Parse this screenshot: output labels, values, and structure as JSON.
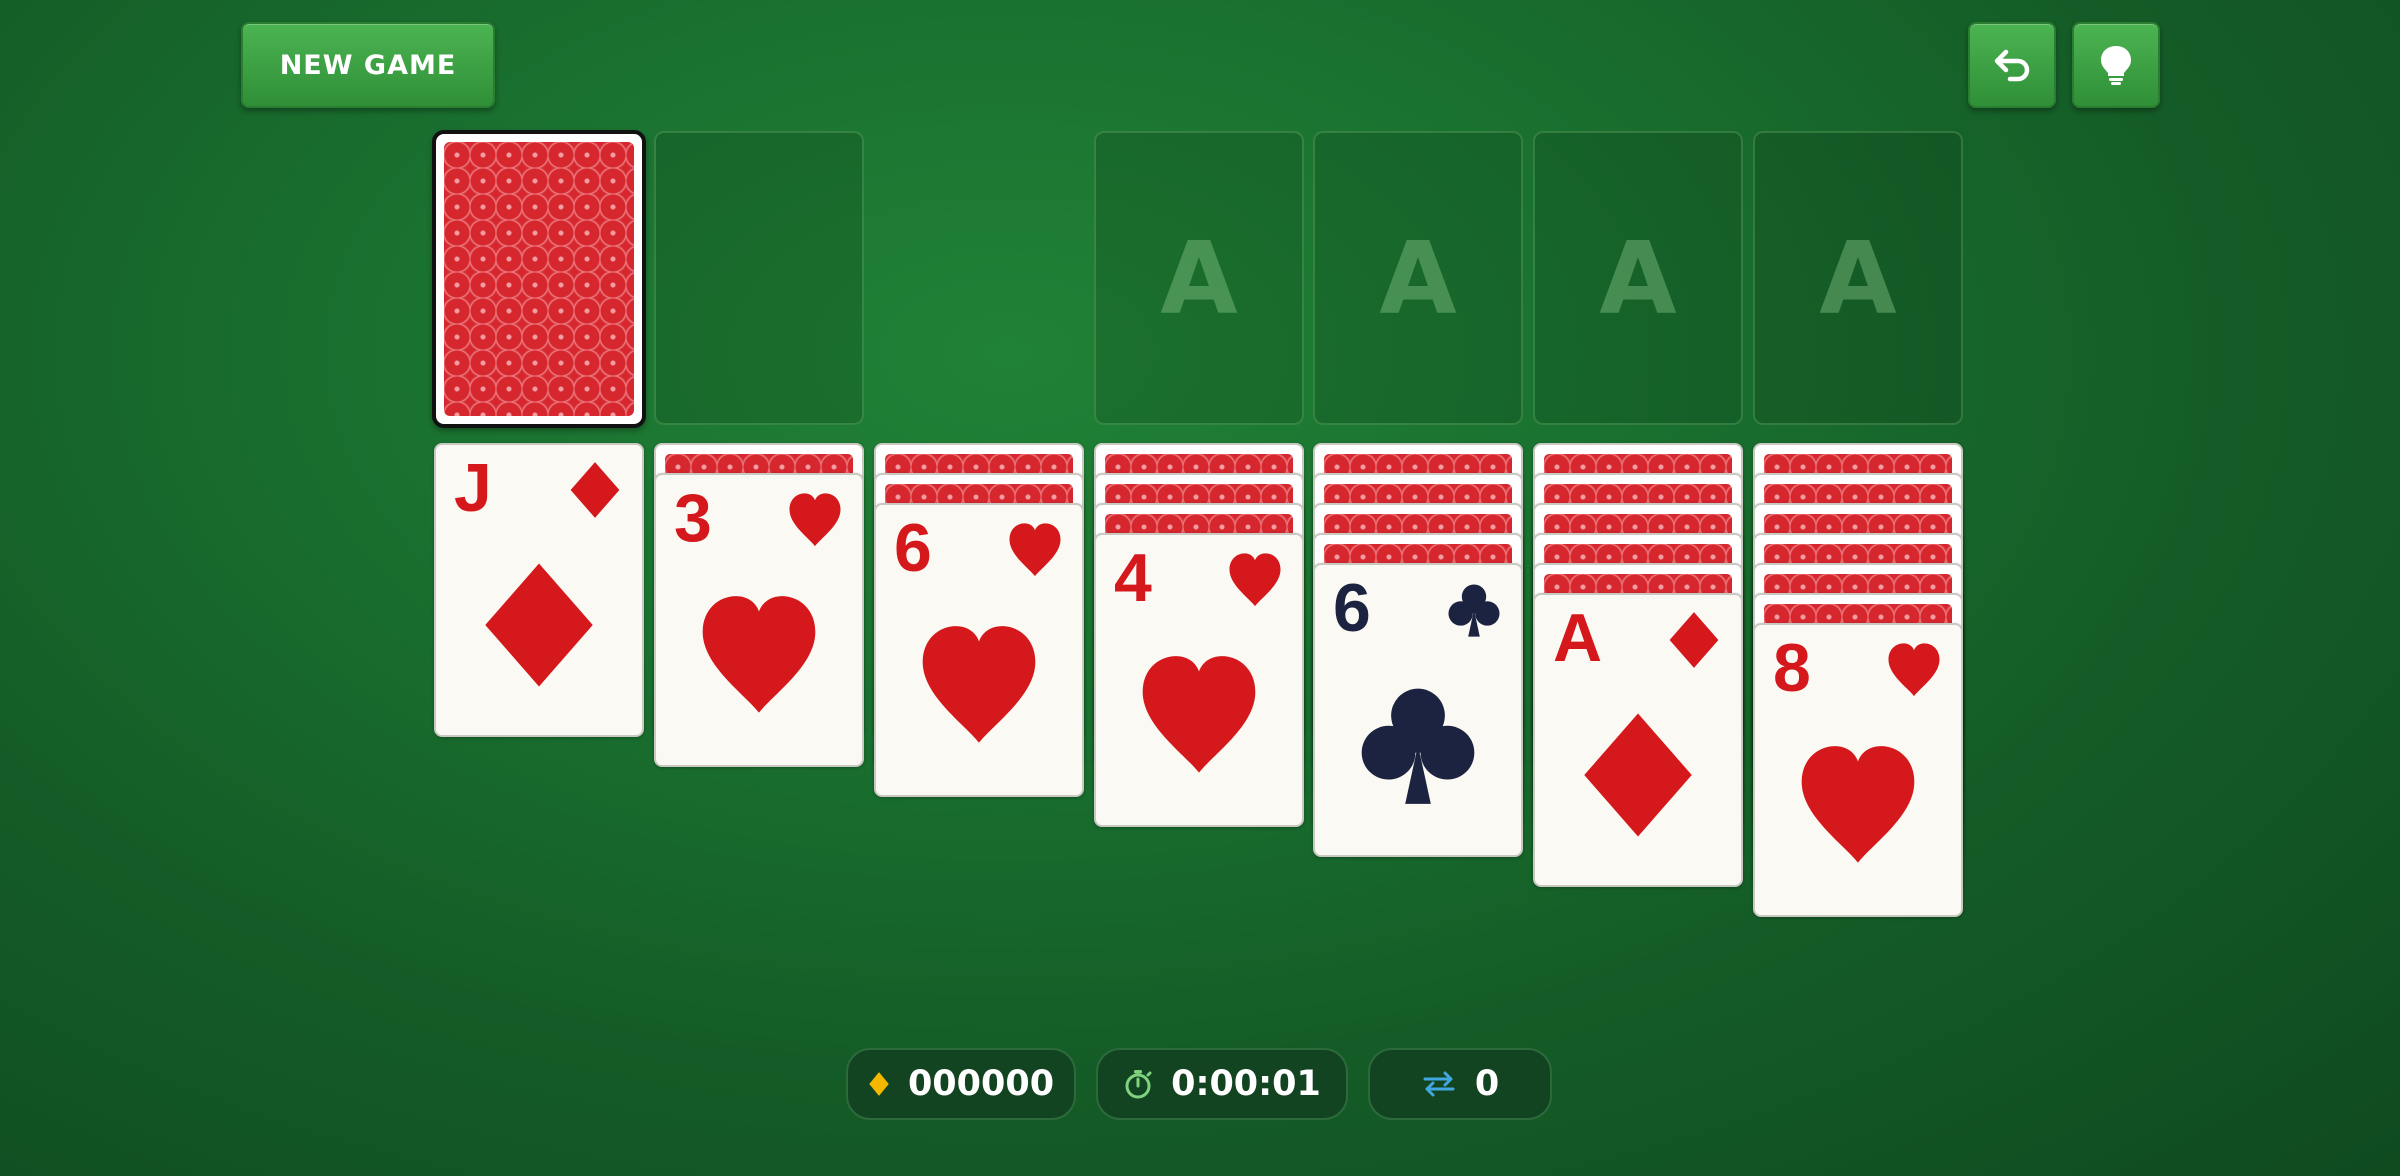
{
  "toolbar": {
    "new_game_label": "NEW GAME",
    "undo_icon": "undo-arrow-icon",
    "hint_icon": "lightbulb-icon"
  },
  "foundations": [
    {
      "label": "A"
    },
    {
      "label": "A"
    },
    {
      "label": "A"
    },
    {
      "label": "A"
    }
  ],
  "tableau": [
    {
      "face_down": 0,
      "top": {
        "rank": "J",
        "suit": "diamonds",
        "color": "red"
      }
    },
    {
      "face_down": 1,
      "top": {
        "rank": "3",
        "suit": "hearts",
        "color": "red"
      }
    },
    {
      "face_down": 2,
      "top": {
        "rank": "6",
        "suit": "hearts",
        "color": "red"
      }
    },
    {
      "face_down": 3,
      "top": {
        "rank": "4",
        "suit": "hearts",
        "color": "red"
      }
    },
    {
      "face_down": 4,
      "top": {
        "rank": "6",
        "suit": "clubs",
        "color": "black"
      }
    },
    {
      "face_down": 5,
      "top": {
        "rank": "A",
        "suit": "diamonds",
        "color": "red"
      }
    },
    {
      "face_down": 6,
      "top": {
        "rank": "8",
        "suit": "hearts",
        "color": "red"
      }
    }
  ],
  "status": {
    "score": "000000",
    "time": "0:00:01",
    "moves": "0",
    "score_icon": "diamond-icon",
    "time_icon": "stopwatch-icon",
    "moves_icon": "swap-arrows-icon"
  },
  "colors": {
    "felt": "#1a7230",
    "card_back": "#d6262e",
    "red_suit": "#d5181c",
    "black_suit": "#1b2340",
    "score_icon": "#f5b800",
    "time_icon": "#7fd37f",
    "moves_icon": "#3fa8e0"
  }
}
